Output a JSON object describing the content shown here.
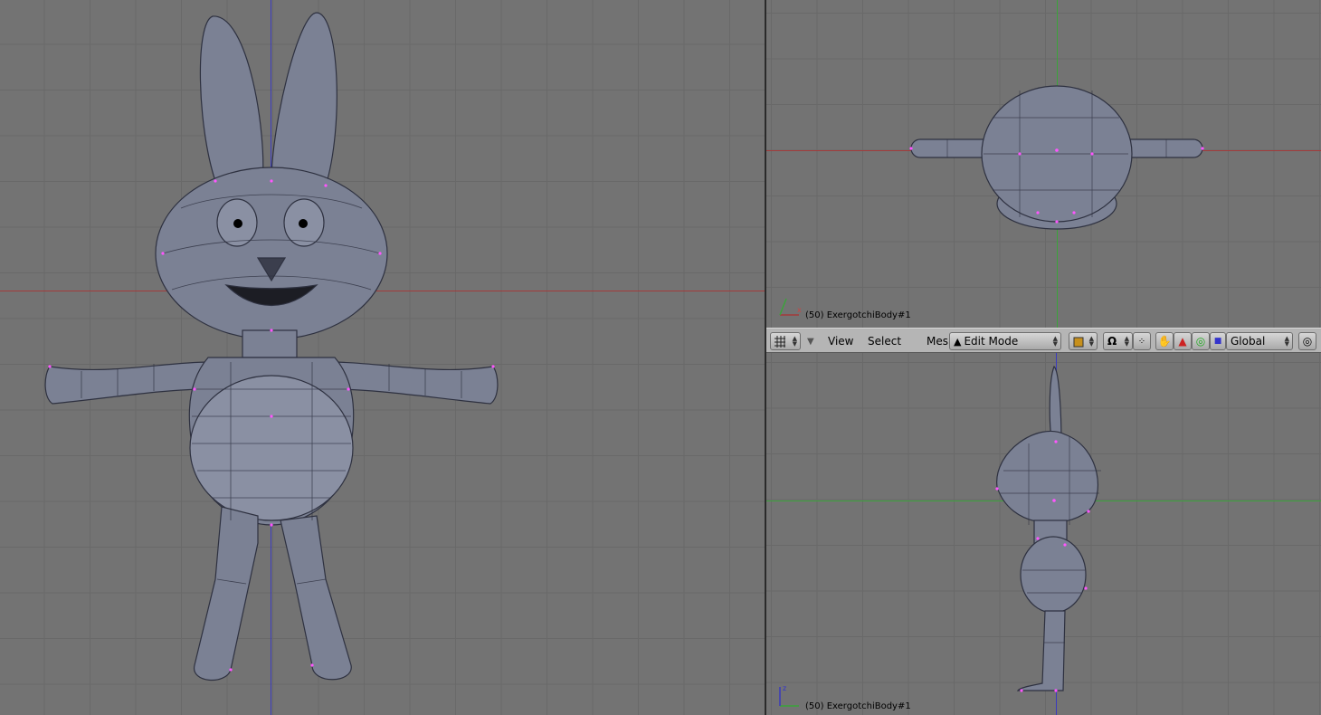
{
  "viewports": {
    "front": {
      "label": ""
    },
    "top": {
      "label": "(50) ExergotchiBody#1",
      "axis_x": "x"
    },
    "side": {
      "label": "(50) ExergotchiBody#1",
      "axis_z": "z"
    }
  },
  "header": {
    "menus": [
      "View",
      "Select",
      "Mesh"
    ],
    "mode": "Edit Mode",
    "orientation": "Global"
  },
  "icons": {
    "viewport_type": "grid-icon",
    "menu_toggle": "triangle-down-icon",
    "draw_type": "cube-icon",
    "pivot": "magnet-icon",
    "manipulator": "hand-icon",
    "translate": "triangle-icon",
    "rotate": "circle-icon",
    "scale": "square-icon",
    "occlusion": "target-icon"
  },
  "colors": {
    "grid_bg": "#737373",
    "axis_red": "#a33b3b",
    "axis_green": "#3ba33b",
    "axis_blue": "#3b3bbd",
    "mesh": "#7b8194",
    "vertex": "#ff55ff"
  }
}
